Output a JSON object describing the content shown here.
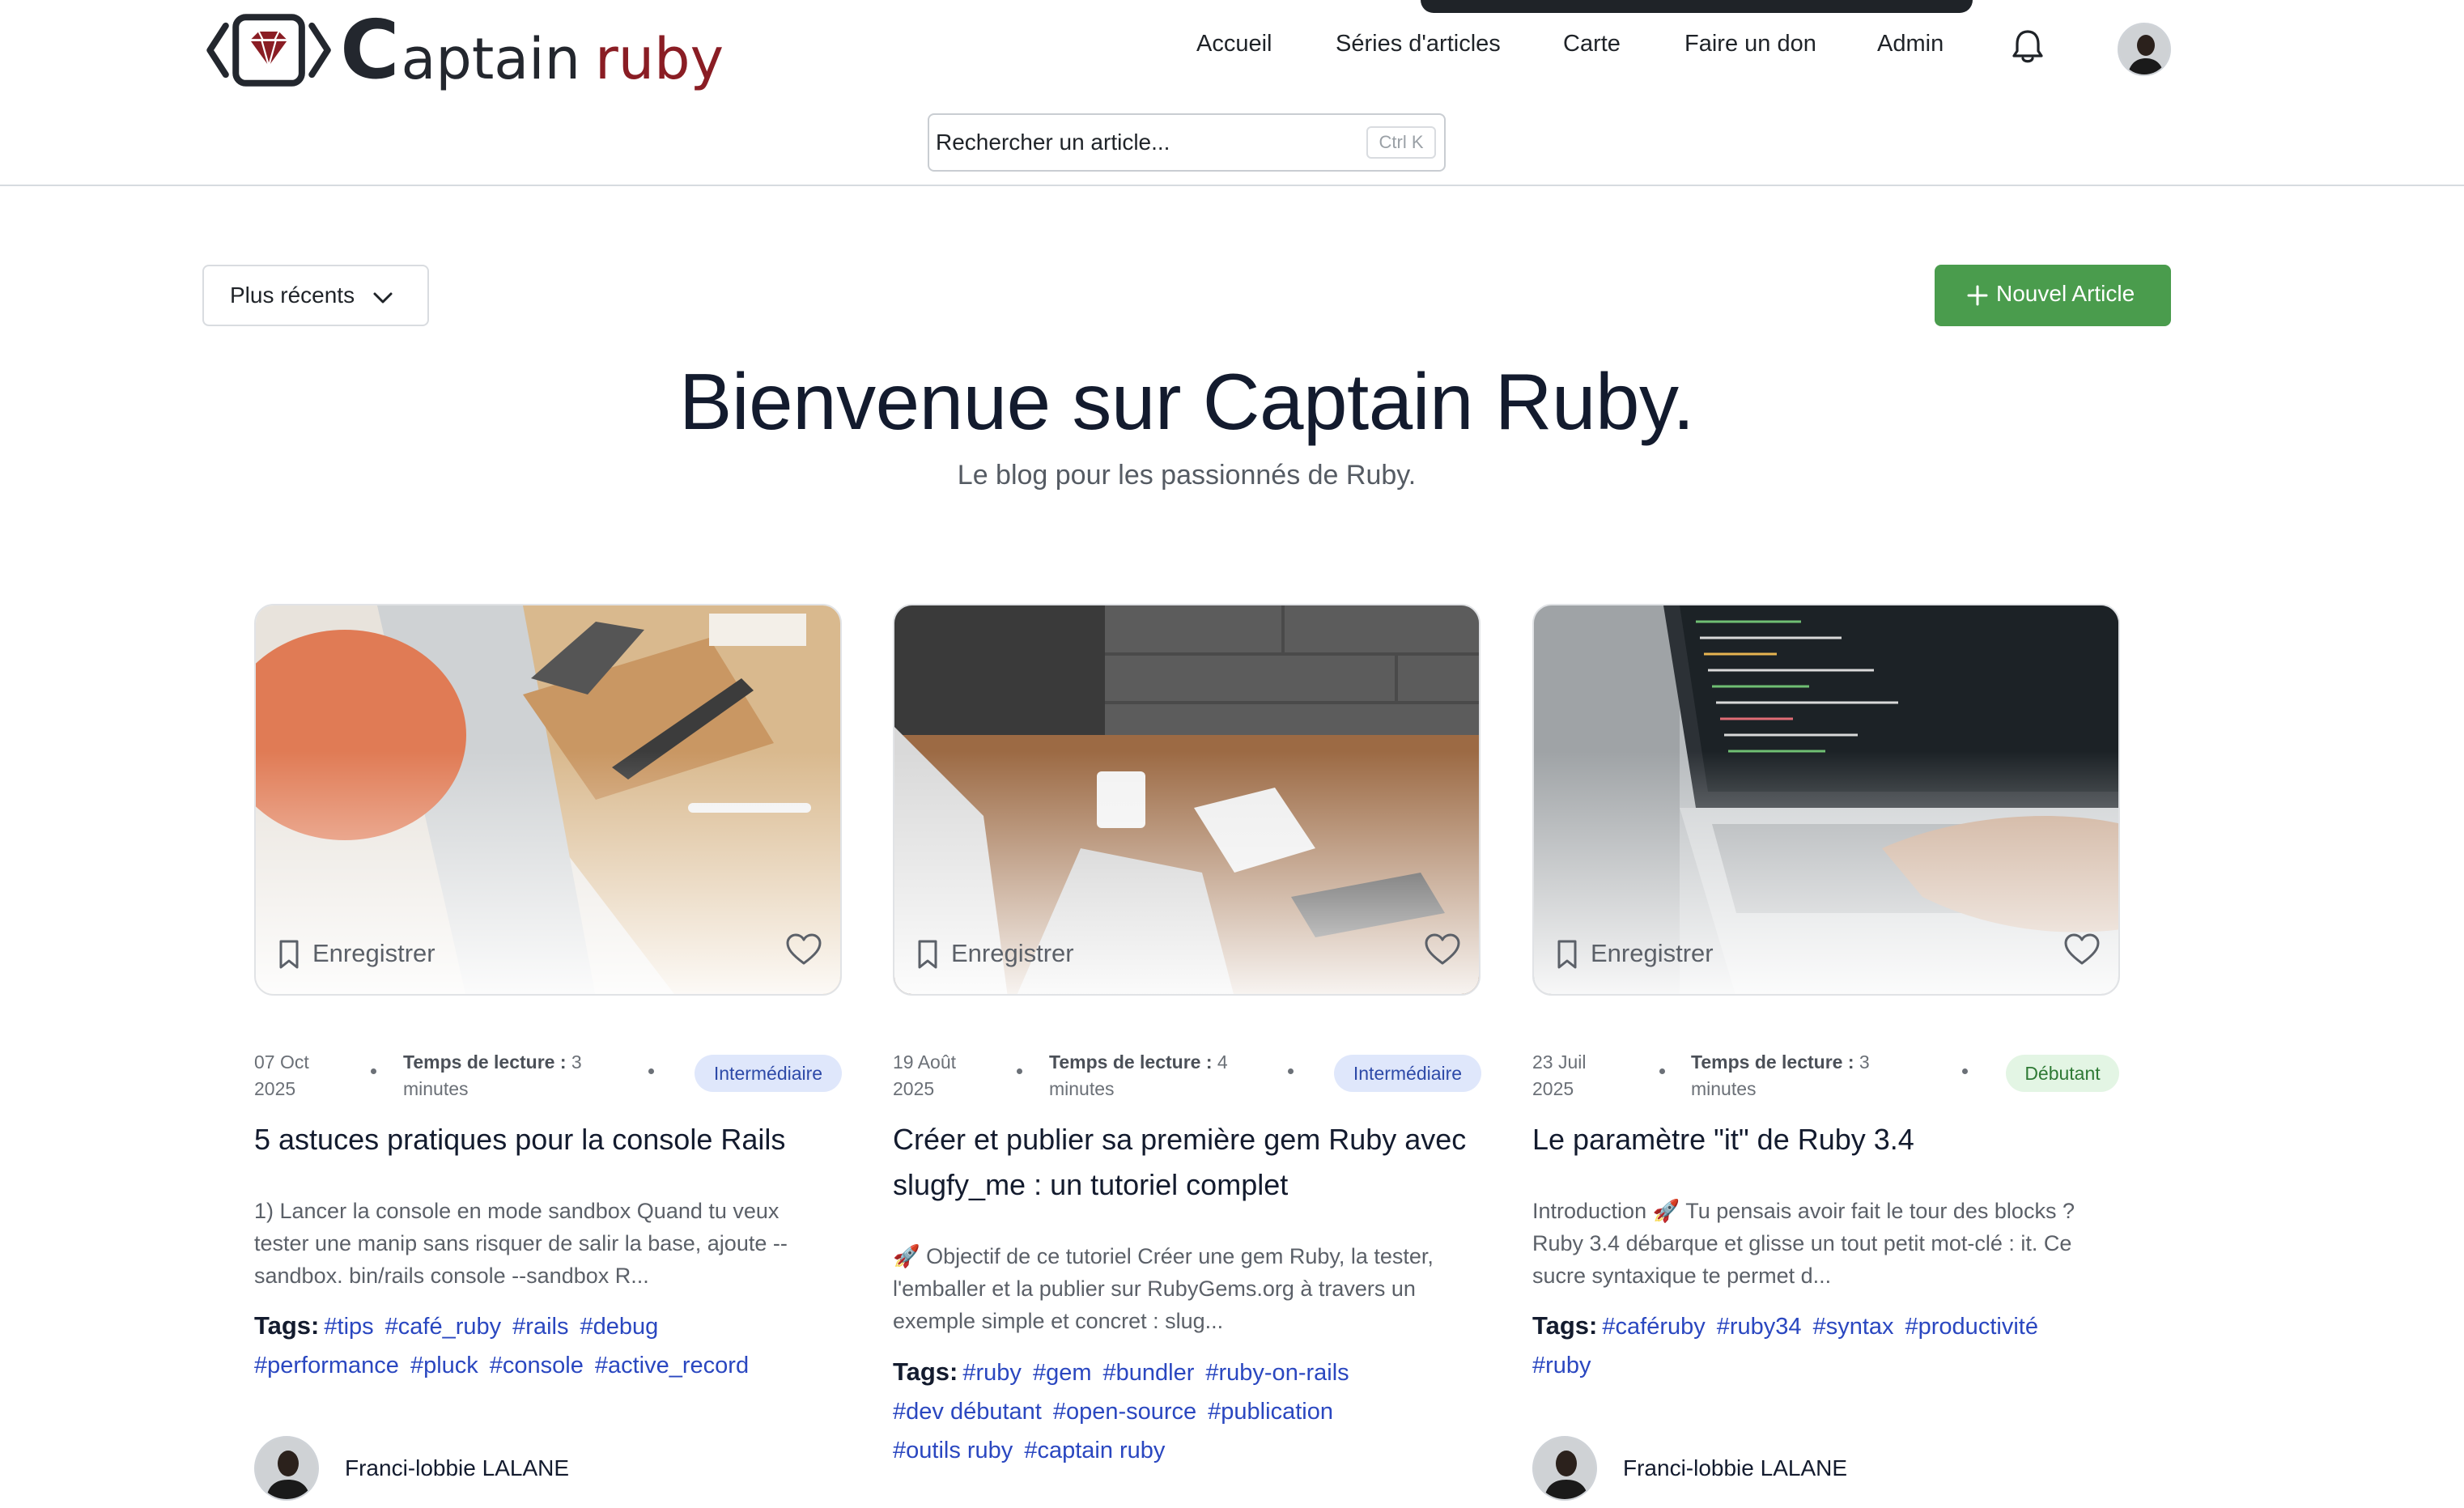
{
  "brand": {
    "logo_letter": "C",
    "logo_word1": "aptain",
    "logo_word2": "ruby",
    "accent": "#8a1d24"
  },
  "nav": {
    "items": [
      "Accueil",
      "Séries d'articles",
      "Carte",
      "Faire un don",
      "Admin"
    ],
    "bell_icon": "bell-icon"
  },
  "search": {
    "placeholder": "Rechercher un article...",
    "shortcut": "Ctrl K"
  },
  "toolbar": {
    "sort_label": "Plus récents",
    "new_article_label": "Nouvel Article",
    "new_article_color": "#4a9c4d"
  },
  "hero": {
    "title": "Bienvenue sur Captain Ruby.",
    "subtitle": "Le blog pour les passionnés de Ruby."
  },
  "cards": [
    {
      "save_label": "Enregistrer",
      "date_line1": "07 Oct",
      "date_line2": "2025",
      "read_label": "Temps de lecture :",
      "read_value": "3",
      "read_unit": "minutes",
      "level": "Intermédiaire",
      "title": "5 astuces pratiques pour la console Rails",
      "excerpt": "1) Lancer la console en mode sandbox Quand tu veux tester une manip sans risquer de salir la base, ajoute --sandbox. bin/rails console --sandbox R...",
      "tags_label": "Tags:",
      "tags": [
        "#tips",
        "#café_ruby",
        "#rails",
        "#debug",
        "#performance",
        "#pluck",
        "#console",
        "#active_record"
      ],
      "author": "Franci-lobbie LALANE"
    },
    {
      "save_label": "Enregistrer",
      "date_line1": "19 Août",
      "date_line2": "2025",
      "read_label": "Temps de lecture :",
      "read_value": "4",
      "read_unit": "minutes",
      "level": "Intermédiaire",
      "title": "Créer et publier sa première gem Ruby avec slugfy_me : un tutoriel complet",
      "excerpt": "🚀 Objectif de ce tutoriel Créer une gem Ruby, la tester, l'emballer et la publier sur RubyGems.org à travers un exemple simple et concret : slug...",
      "tags_label": "Tags:",
      "tags": [
        "#ruby",
        "#gem",
        "#bundler",
        "#ruby-on-rails",
        "#dev débutant",
        "#open-source",
        "#publication",
        "#outils ruby",
        "#captain ruby"
      ],
      "author": ""
    },
    {
      "save_label": "Enregistrer",
      "date_line1": "23 Juil",
      "date_line2": "2025",
      "read_label": "Temps de lecture :",
      "read_value": "3",
      "read_unit": "minutes",
      "level": "Débutant",
      "title": "Le paramètre \"it\" de Ruby 3.4",
      "excerpt": "Introduction 🚀 Tu pensais avoir fait le tour des blocks ? Ruby 3.4 débarque et glisse un tout petit mot-clé : it. Ce sucre syntaxique te permet d...",
      "tags_label": "Tags:",
      "tags": [
        "#caféruby",
        "#ruby34",
        "#syntax",
        "#productivité",
        "#ruby"
      ],
      "author": "Franci-lobbie LALANE"
    }
  ]
}
